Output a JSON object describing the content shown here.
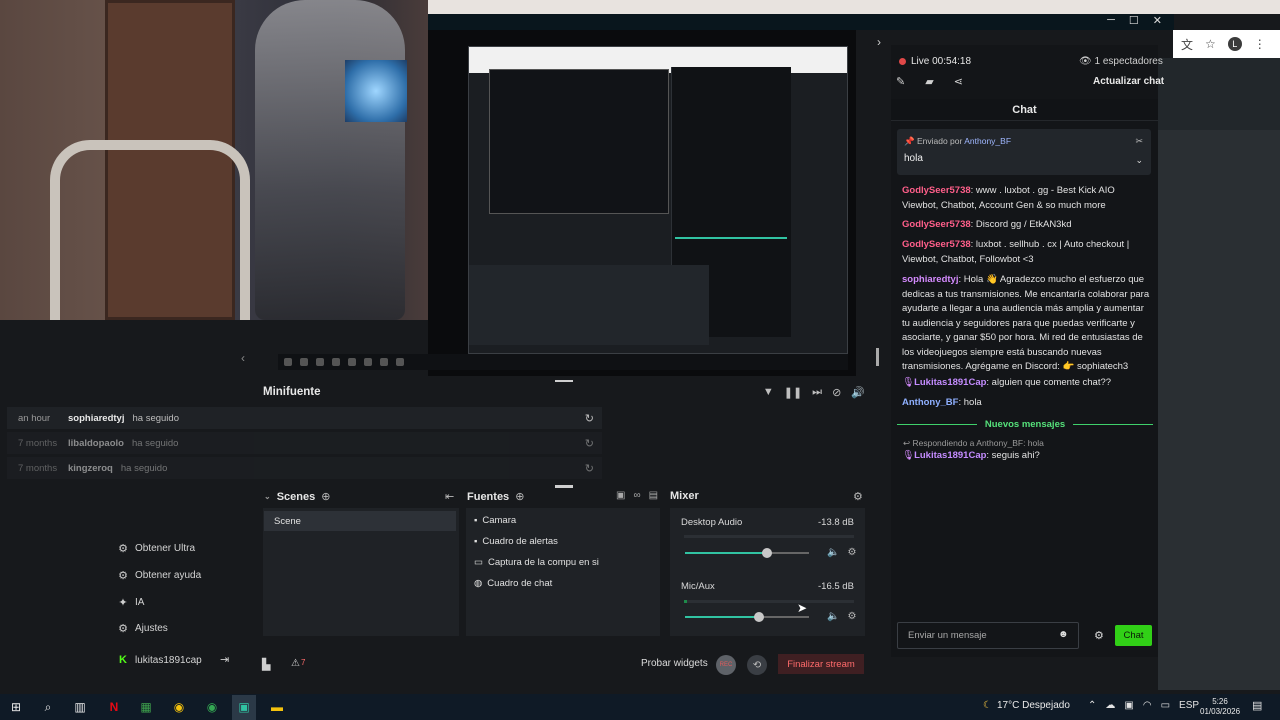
{
  "window_controls": {
    "minimize": "─",
    "maximize": "☐",
    "close": "✕"
  },
  "browser": {
    "avatar_letter": "L"
  },
  "nav": {
    "items": [
      {
        "label": "Obtener Ultra",
        "icon": "ultra-icon"
      },
      {
        "label": "Obtener ayuda",
        "icon": "help-icon"
      },
      {
        "label": "IA",
        "icon": "ai-icon"
      },
      {
        "label": "Ajustes",
        "icon": "gear-icon"
      }
    ],
    "user": {
      "name": "lukitas1891cap",
      "logout_icon": "logout-icon"
    }
  },
  "minifuente": {
    "title": "Minifuente",
    "events": [
      {
        "time": "an hour",
        "user": "sophiaredtyj",
        "action": "ha seguido"
      },
      {
        "time": "7 months",
        "user": "libaldopaolo",
        "action": "ha seguido"
      },
      {
        "time": "7 months",
        "user": "kingzeroq",
        "action": "ha seguido"
      }
    ]
  },
  "scenes": {
    "title": "Scenes",
    "items": [
      "Scene"
    ]
  },
  "sources": {
    "title": "Fuentes",
    "items": [
      {
        "label": "Camara",
        "icon": "camera-icon"
      },
      {
        "label": "Cuadro de alertas",
        "icon": "alert-box-icon"
      },
      {
        "label": "Captura de la compu en si",
        "icon": "monitor-icon"
      },
      {
        "label": "Cuadro de chat",
        "icon": "chat-bubble-icon"
      }
    ]
  },
  "mixer": {
    "title": "Mixer",
    "channels": [
      {
        "name": "Desktop Audio",
        "db": "-13.8 dB",
        "volume": 0.66,
        "level": 0.0
      },
      {
        "name": "Mic/Aux",
        "db": "-16.5 dB",
        "volume": 0.6,
        "level": 0.02
      }
    ]
  },
  "footer": {
    "warnings_count": "7",
    "probar_widgets": "Probar widgets",
    "rec_label": "REC",
    "end_stream": "Finalizar stream"
  },
  "chat": {
    "live_label": "Live 00:54:18",
    "viewers": "1 espectadores",
    "refresh": "Actualizar chat",
    "header": "Chat",
    "pinned": {
      "prefix": "Enviado por",
      "author": "Anthony_BF",
      "message": "hola"
    },
    "messages": [
      {
        "user": "GodlySeer5738",
        "text": ": www . luxbot . gg - Best Kick AIO Viewbot, Chatbot, Account Gen & so much more"
      },
      {
        "user": "GodlySeer5738",
        "text": ": Discord gg / EtkAN3kd"
      },
      {
        "user": "GodlySeer5738",
        "text": ": luxbot . sellhub . cx | Auto checkout | Viewbot, Chatbot, Followbot <3"
      },
      {
        "user": "sophiaredtyj",
        "text": ": Hola 👋 Agradezco mucho el esfuerzo que dedicas a tus transmisiones. Me encantaría colaborar para ayudarte a llegar a una audiencia más amplia y aumentar tu audiencia y seguidores para que puedas verificarte y asociarte, y ganar $50 por hora. Mi red de entusiastas de los videojuegos siempre está buscando nuevas transmisiones. Agrégame en Discord: 👉 sophiatech3"
      },
      {
        "user": "Lukitas1891Cap",
        "text": ": alguien que comente chat??"
      },
      {
        "user": "Anthony_BF",
        "text": ": hola"
      }
    ],
    "new_messages": "Nuevos mensajes",
    "reply_to": "Respondiendo a Anthony_BF: hola",
    "after_new": {
      "user": "Lukitas1891Cap",
      "text": ": seguis ahi?"
    },
    "input_placeholder": "Enviar un mensaje",
    "send": "Chat"
  },
  "taskbar": {
    "weather": "17°C  Despejado",
    "lang": "ESP",
    "time": "5:26",
    "date": "01/03/2026"
  }
}
